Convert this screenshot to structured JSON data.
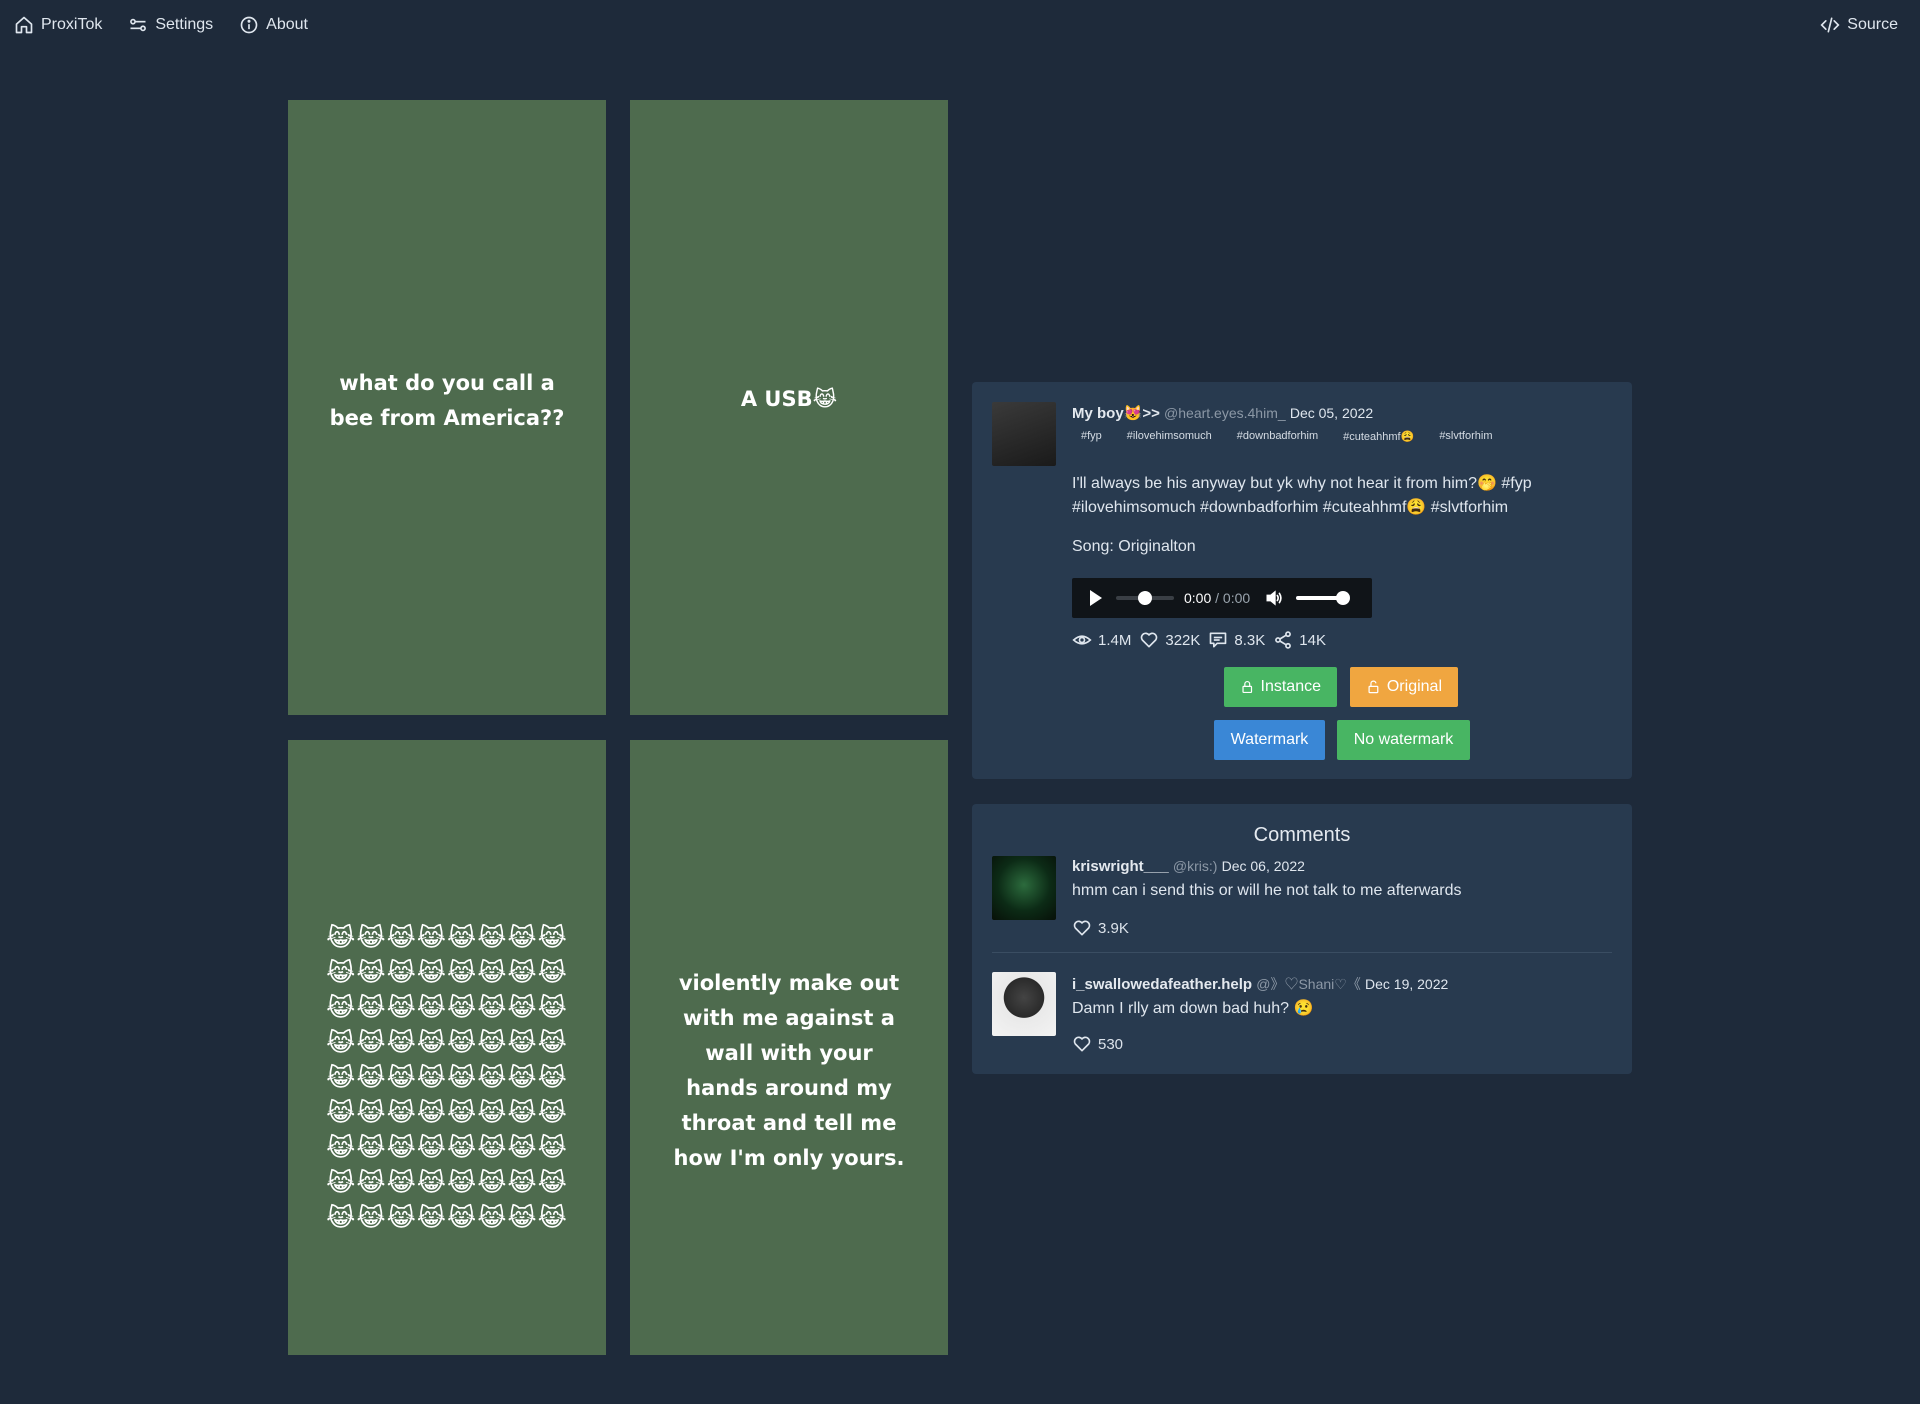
{
  "nav": {
    "brand": "ProxiTok",
    "settings": "Settings",
    "about": "About",
    "source": "Source"
  },
  "slides": [
    {
      "caption": "what do you call a bee from America??"
    },
    {
      "caption": "A USB😹"
    },
    {
      "caption": "😹😹😹😹😹😹😹😹😹😹😹😹😹😹😹😹😹😹😹😹😹😹😹😹😹😹😹😹😹😹😹😹😹😹😹😹😹😹😹😹😹😹😹😹😹😹😹😹😹😹😹😹😹😹😹😹😹😹😹😹😹😹😹😹😹😹😹😹😹😹😹😹"
    },
    {
      "caption": "violently make out with me against a wall with your hands around my throat and tell me how I'm only yours."
    }
  ],
  "video": {
    "author_name": "My boy😻>>",
    "author_handle": "@heart.eyes.4him_",
    "date": "Dec 05, 2022",
    "tags": [
      "#fyp",
      "#ilovehimsomuch",
      "#downbadforhim",
      "#cuteahhmf😩",
      "#slvtforhim"
    ],
    "description": "I'll always be his anyway but yk why not hear it from him?🤭 #fyp #ilovehimsomuch #downbadforhim #cuteahhmf😩 #slvtforhim",
    "song": "Song: Originalton",
    "player": {
      "current": "0:00",
      "duration": "/ 0:00",
      "progress": 0.5,
      "volume": 1.0
    },
    "stats": {
      "views": "1.4M",
      "likes": "322K",
      "comments": "8.3K",
      "shares": "14K"
    },
    "buttons": {
      "instance": "Instance",
      "original": "Original",
      "watermark": "Watermark",
      "no_watermark": "No watermark"
    },
    "colors": {
      "instance": "#48b563",
      "original": "#f0a640",
      "watermark": "#3a87d6"
    }
  },
  "comments": {
    "title": "Comments",
    "items": [
      {
        "name": "kriswright___",
        "handle": "@kris:)",
        "date": "Dec 06, 2022",
        "text": "hmm can i send this or will he not talk to me afterwards",
        "likes": "3.9K"
      },
      {
        "name": "i_swallowedafeather.help",
        "handle": "@》♡Shani♡《",
        "date": "Dec 19, 2022",
        "text": "Damn I rlly am down bad huh? 😢",
        "likes": "530"
      }
    ]
  }
}
